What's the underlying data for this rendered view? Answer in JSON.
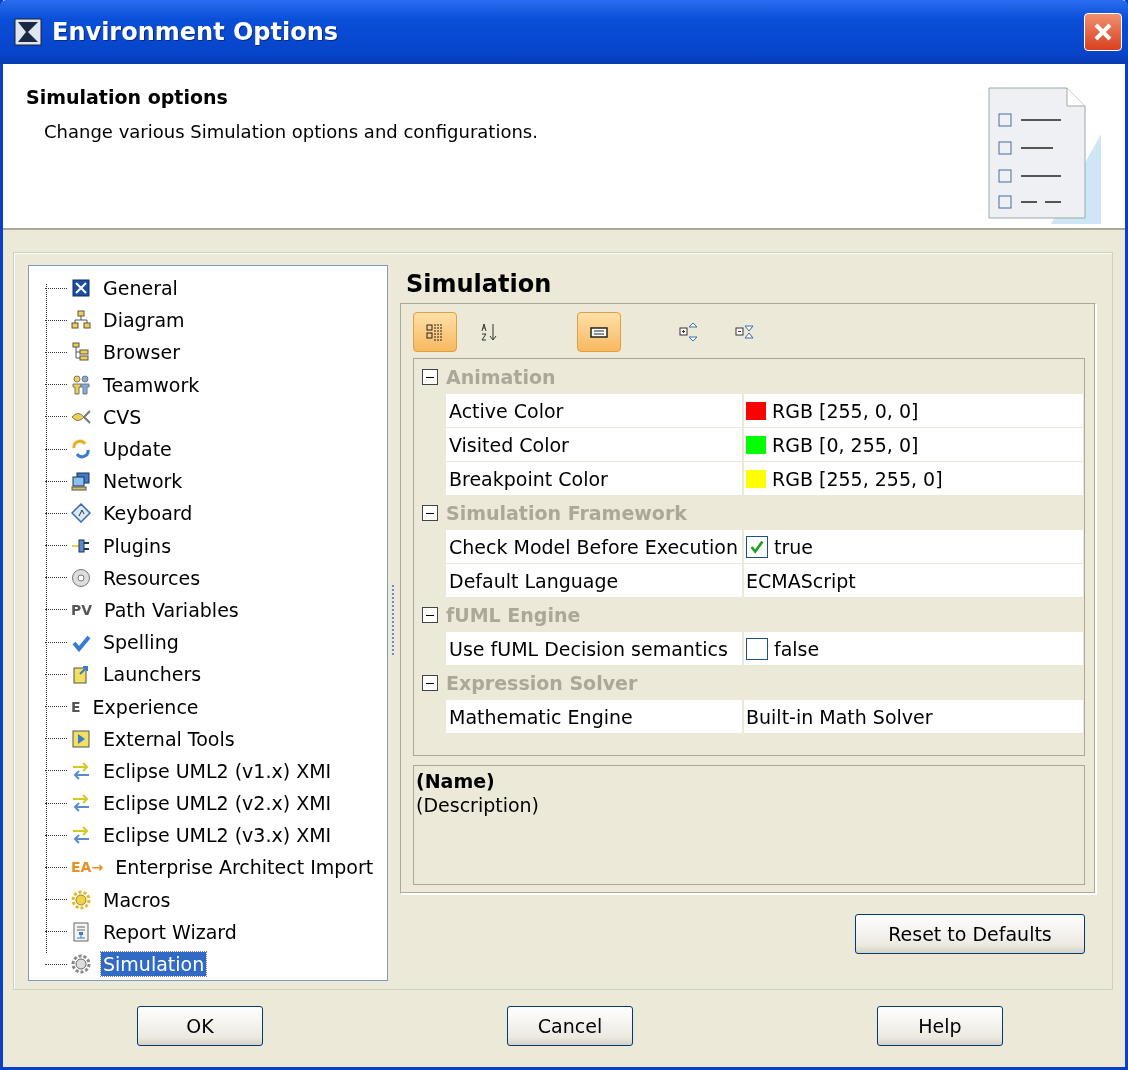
{
  "window": {
    "title": "Environment Options"
  },
  "header": {
    "title": "Simulation options",
    "description": "Change various Simulation options and configurations."
  },
  "tree": [
    {
      "label": "General",
      "selected": false
    },
    {
      "label": "Diagram",
      "selected": false
    },
    {
      "label": "Browser",
      "selected": false
    },
    {
      "label": "Teamwork",
      "selected": false
    },
    {
      "label": "CVS",
      "selected": false
    },
    {
      "label": "Update",
      "selected": false
    },
    {
      "label": "Network",
      "selected": false
    },
    {
      "label": "Keyboard",
      "selected": false
    },
    {
      "label": "Plugins",
      "selected": false
    },
    {
      "label": "Resources",
      "selected": false
    },
    {
      "label": "Path Variables",
      "selected": false,
      "icon_text": "PV"
    },
    {
      "label": "Spelling",
      "selected": false
    },
    {
      "label": "Launchers",
      "selected": false
    },
    {
      "label": "Experience",
      "selected": false,
      "icon_text": "E"
    },
    {
      "label": "External Tools",
      "selected": false
    },
    {
      "label": "Eclipse UML2 (v1.x) XMI",
      "selected": false
    },
    {
      "label": "Eclipse UML2 (v2.x) XMI",
      "selected": false
    },
    {
      "label": "Eclipse UML2 (v3.x) XMI",
      "selected": false
    },
    {
      "label": "Enterprise Architect Import",
      "selected": false,
      "icon_text": "EA→"
    },
    {
      "label": "Macros",
      "selected": false
    },
    {
      "label": "Report Wizard",
      "selected": false
    },
    {
      "label": "Simulation",
      "selected": true
    }
  ],
  "panel": {
    "title": "Simulation",
    "toolbar": [
      {
        "selected": true
      },
      {
        "selected": false
      },
      {
        "selected": true
      },
      {
        "selected": false
      },
      {
        "selected": false
      }
    ],
    "groups": [
      {
        "name": "Animation",
        "expanded": true,
        "rows": [
          {
            "kind": "color",
            "name": "Active Color",
            "value": "RGB [255, 0, 0]",
            "color": "#ff0000"
          },
          {
            "kind": "color",
            "name": "Visited Color",
            "value": "RGB [0, 255, 0]",
            "color": "#00ff00"
          },
          {
            "kind": "color",
            "name": "Breakpoint Color",
            "value": "RGB [255, 255, 0]",
            "color": "#ffff00"
          }
        ]
      },
      {
        "name": "Simulation Framework",
        "expanded": true,
        "rows": [
          {
            "kind": "checkbox",
            "name": "Check Model Before Execution",
            "value": "true",
            "checked": true
          },
          {
            "kind": "text",
            "name": "Default Language",
            "value": "ECMAScript"
          }
        ]
      },
      {
        "name": "fUML Engine",
        "expanded": true,
        "rows": [
          {
            "kind": "checkbox",
            "name": "Use fUML Decision semantics",
            "value": "false",
            "checked": false
          }
        ]
      },
      {
        "name": "Expression Solver",
        "expanded": true,
        "rows": [
          {
            "kind": "text",
            "name": "Mathematic Engine",
            "value": "Built-in Math Solver"
          }
        ]
      }
    ],
    "description": {
      "name": "(Name)",
      "text": "(Description)"
    },
    "reset_button": "Reset to Defaults"
  },
  "buttons": [
    "OK",
    "Cancel",
    "Help"
  ]
}
